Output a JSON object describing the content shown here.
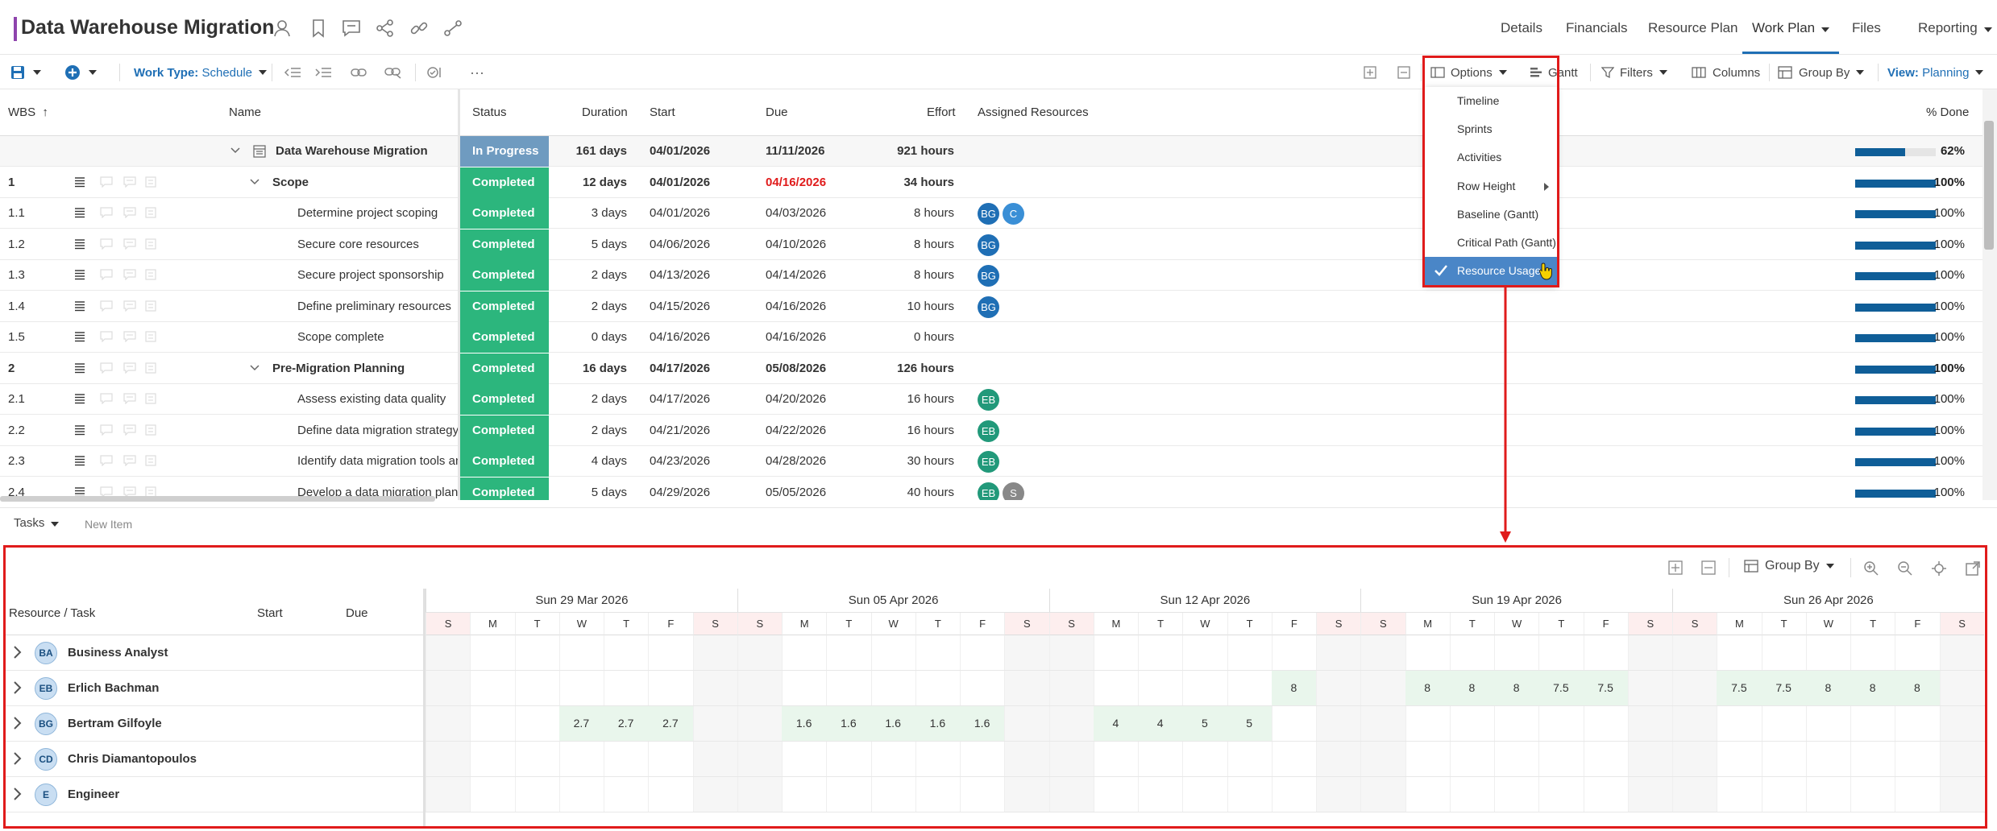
{
  "header": {
    "title": "Data Warehouse Migration",
    "nav": [
      {
        "label": "Details"
      },
      {
        "label": "Financials"
      },
      {
        "label": "Resource Plan"
      },
      {
        "label": "Work Plan"
      },
      {
        "label": "Files"
      },
      {
        "label": "Reporting"
      }
    ],
    "active_nav": "Work Plan"
  },
  "toolbar": {
    "work_type_label": "Work Type:",
    "work_type_value": "Schedule",
    "more": "···",
    "options": "Options",
    "gantt": "Gantt",
    "filters": "Filters",
    "columns": "Columns",
    "group_by": "Group By",
    "view_label": "View:",
    "view_value": "Planning"
  },
  "options_menu": {
    "items": [
      {
        "label": "Timeline",
        "checked": false
      },
      {
        "label": "Sprints",
        "checked": false
      },
      {
        "label": "Activities",
        "checked": false
      },
      {
        "label": "Row Height",
        "checked": false,
        "submenu": true
      },
      {
        "label": "Baseline (Gantt)",
        "checked": false
      },
      {
        "label": "Critical Path (Gantt)",
        "checked": false
      },
      {
        "label": "Resource Usage",
        "checked": true
      }
    ]
  },
  "grid": {
    "columns": {
      "wbs": "WBS",
      "name": "Name",
      "status": "Status",
      "duration": "Duration",
      "start": "Start",
      "due": "Due",
      "effort": "Effort",
      "resources": "Assigned Resources",
      "done": "% Done"
    },
    "rows": [
      {
        "wbs": "",
        "name": "Data Warehouse Migration",
        "status": "In Progress",
        "duration": "161 days",
        "start": "04/01/2026",
        "due": "11/11/2026",
        "effort": "921 hours",
        "resources": [],
        "pct": "62%",
        "fill": 0.62,
        "level": 0,
        "bold": true
      },
      {
        "wbs": "1",
        "name": "Scope",
        "status": "Completed",
        "duration": "12 days",
        "start": "04/01/2026",
        "due": "04/16/2026",
        "due_red": true,
        "effort": "34 hours",
        "resources": [],
        "pct": "100%",
        "fill": 1,
        "level": 1,
        "bold": true
      },
      {
        "wbs": "1.1",
        "name": "Determine project scoping",
        "status": "Completed",
        "duration": "3 days",
        "start": "04/01/2026",
        "due": "04/03/2026",
        "effort": "8 hours",
        "resources": [
          "BG",
          "C"
        ],
        "pct": "100%",
        "fill": 1,
        "level": 2
      },
      {
        "wbs": "1.2",
        "name": "Secure core resources",
        "status": "Completed",
        "duration": "5 days",
        "start": "04/06/2026",
        "due": "04/10/2026",
        "effort": "8 hours",
        "resources": [
          "BG"
        ],
        "pct": "100%",
        "fill": 1,
        "level": 2
      },
      {
        "wbs": "1.3",
        "name": "Secure project sponsorship",
        "status": "Completed",
        "duration": "2 days",
        "start": "04/13/2026",
        "due": "04/14/2026",
        "effort": "8 hours",
        "resources": [
          "BG"
        ],
        "pct": "100%",
        "fill": 1,
        "level": 2
      },
      {
        "wbs": "1.4",
        "name": "Define preliminary resources",
        "status": "Completed",
        "duration": "2 days",
        "start": "04/15/2026",
        "due": "04/16/2026",
        "effort": "10 hours",
        "resources": [
          "BG"
        ],
        "pct": "100%",
        "fill": 1,
        "level": 2
      },
      {
        "wbs": "1.5",
        "name": "Scope complete",
        "status": "Completed",
        "duration": "0 days",
        "start": "04/16/2026",
        "due": "04/16/2026",
        "effort": "0 hours",
        "resources": [],
        "pct": "100%",
        "fill": 1,
        "level": 2
      },
      {
        "wbs": "2",
        "name": "Pre-Migration Planning",
        "status": "Completed",
        "duration": "16 days",
        "start": "04/17/2026",
        "due": "05/08/2026",
        "effort": "126 hours",
        "resources": [],
        "pct": "100%",
        "fill": 1,
        "level": 1,
        "bold": true
      },
      {
        "wbs": "2.1",
        "name": "Assess existing data quality",
        "status": "Completed",
        "duration": "2 days",
        "start": "04/17/2026",
        "due": "04/20/2026",
        "effort": "16 hours",
        "resources": [
          "EB"
        ],
        "pct": "100%",
        "fill": 1,
        "level": 2
      },
      {
        "wbs": "2.2",
        "name": "Define data migration strategy",
        "status": "Completed",
        "duration": "2 days",
        "start": "04/21/2026",
        "due": "04/22/2026",
        "effort": "16 hours",
        "resources": [
          "EB"
        ],
        "pct": "100%",
        "fill": 1,
        "level": 2
      },
      {
        "wbs": "2.3",
        "name": "Identify data migration tools an",
        "status": "Completed",
        "duration": "4 days",
        "start": "04/23/2026",
        "due": "04/28/2026",
        "effort": "30 hours",
        "resources": [
          "EB"
        ],
        "pct": "100%",
        "fill": 1,
        "level": 2
      },
      {
        "wbs": "2.4",
        "name": "Develop a data migration plan",
        "status": "Completed",
        "duration": "5 days",
        "start": "04/29/2026",
        "due": "05/05/2026",
        "effort": "40 hours",
        "resources": [
          "EB",
          "S"
        ],
        "pct": "100%",
        "fill": 1,
        "level": 2
      }
    ]
  },
  "tabs": {
    "tasks": "Tasks",
    "new_item": "New Item"
  },
  "resource_usage": {
    "toolbar_group_by": "Group By",
    "columns": {
      "resource": "Resource / Task",
      "start": "Start",
      "due": "Due"
    },
    "weeks": [
      "Sun 29 Mar 2026",
      "Sun 05 Apr 2026",
      "Sun 12 Apr 2026",
      "Sun 19 Apr 2026",
      "Sun 26 Apr 2026"
    ],
    "day_letters": [
      "S",
      "M",
      "T",
      "W",
      "T",
      "F",
      "S"
    ],
    "resources": [
      {
        "initials": "BA",
        "name": "Business Analyst",
        "hours": []
      },
      {
        "initials": "EB",
        "name": "Erlich Bachman",
        "hours": [
          {
            "day": 19,
            "value": "8"
          },
          {
            "day": 22,
            "value": "8"
          },
          {
            "day": 23,
            "value": "8"
          },
          {
            "day": 24,
            "value": "8"
          },
          {
            "day": 25,
            "value": "7.5"
          },
          {
            "day": 26,
            "value": "7.5"
          },
          {
            "day": 29,
            "value": "7.5"
          },
          {
            "day": 30,
            "value": "7.5"
          },
          {
            "day": 31,
            "value": "8"
          },
          {
            "day": 32,
            "value": "8"
          },
          {
            "day": 33,
            "value": "8"
          }
        ]
      },
      {
        "initials": "BG",
        "name": "Bertram Gilfoyle",
        "hours": [
          {
            "day": 3,
            "value": "2.7"
          },
          {
            "day": 4,
            "value": "2.7"
          },
          {
            "day": 5,
            "value": "2.7"
          },
          {
            "day": 8,
            "value": "1.6"
          },
          {
            "day": 9,
            "value": "1.6"
          },
          {
            "day": 10,
            "value": "1.6"
          },
          {
            "day": 11,
            "value": "1.6"
          },
          {
            "day": 12,
            "value": "1.6"
          },
          {
            "day": 15,
            "value": "4"
          },
          {
            "day": 16,
            "value": "4"
          },
          {
            "day": 17,
            "value": "5"
          },
          {
            "day": 18,
            "value": "5"
          }
        ]
      },
      {
        "initials": "CD",
        "name": "Chris Diamantopoulos",
        "hours": []
      },
      {
        "initials": "E",
        "name": "Engineer",
        "hours": []
      }
    ]
  },
  "colors": {
    "accent": "#1f6fb5",
    "completed": "#2cb67d",
    "in_progress": "#6f9bc0",
    "highlight": "#e01b1b",
    "progress": "#0f5e98"
  }
}
